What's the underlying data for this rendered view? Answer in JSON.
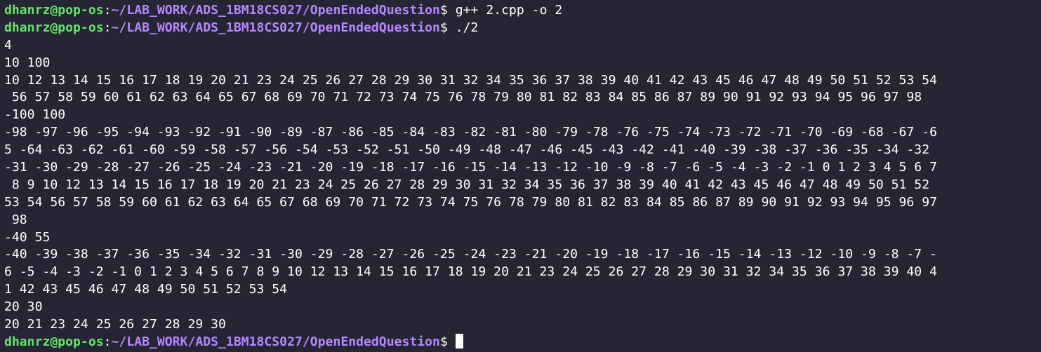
{
  "prompt": {
    "user_host": "dhanrz@pop-os",
    "separator": ":",
    "path": "~/LAB_WORK/ADS_1BM18CS027/OpenEndedQuestion",
    "symbol": "$ "
  },
  "commands": [
    "g++ 2.cpp -o 2",
    "./2"
  ],
  "output_lines": [
    "4",
    "10 100",
    "10 12 13 14 15 16 17 18 19 20 21 23 24 25 26 27 28 29 30 31 32 34 35 36 37 38 39 40 41 42 43 45 46 47 48 49 50 51 52 53 54",
    " 56 57 58 59 60 61 62 63 64 65 67 68 69 70 71 72 73 74 75 76 78 79 80 81 82 83 84 85 86 87 89 90 91 92 93 94 95 96 97 98",
    "-100 100",
    "-98 -97 -96 -95 -94 -93 -92 -91 -90 -89 -87 -86 -85 -84 -83 -82 -81 -80 -79 -78 -76 -75 -74 -73 -72 -71 -70 -69 -68 -67 -6",
    "5 -64 -63 -62 -61 -60 -59 -58 -57 -56 -54 -53 -52 -51 -50 -49 -48 -47 -46 -45 -43 -42 -41 -40 -39 -38 -37 -36 -35 -34 -32",
    "-31 -30 -29 -28 -27 -26 -25 -24 -23 -21 -20 -19 -18 -17 -16 -15 -14 -13 -12 -10 -9 -8 -7 -6 -5 -4 -3 -2 -1 0 1 2 3 4 5 6 7",
    " 8 9 10 12 13 14 15 16 17 18 19 20 21 23 24 25 26 27 28 29 30 31 32 34 35 36 37 38 39 40 41 42 43 45 46 47 48 49 50 51 52",
    "53 54 56 57 58 59 60 61 62 63 64 65 67 68 69 70 71 72 73 74 75 76 78 79 80 81 82 83 84 85 86 87 89 90 91 92 93 94 95 96 97",
    " 98",
    "-40 55",
    "-40 -39 -38 -37 -36 -35 -34 -32 -31 -30 -29 -28 -27 -26 -25 -24 -23 -21 -20 -19 -18 -17 -16 -15 -14 -13 -12 -10 -9 -8 -7 -",
    "6 -5 -4 -3 -2 -1 0 1 2 3 4 5 6 7 8 9 10 12 13 14 15 16 17 18 19 20 21 23 24 25 26 27 28 29 30 31 32 34 35 36 37 38 39 40 4",
    "1 42 43 45 46 47 48 49 50 51 52 53 54",
    "20 30",
    "20 21 23 24 25 26 27 28 29 30"
  ],
  "colors": {
    "background": "#262533",
    "user": "#64e56a",
    "path": "#b686ff",
    "text": "#ffffff"
  }
}
